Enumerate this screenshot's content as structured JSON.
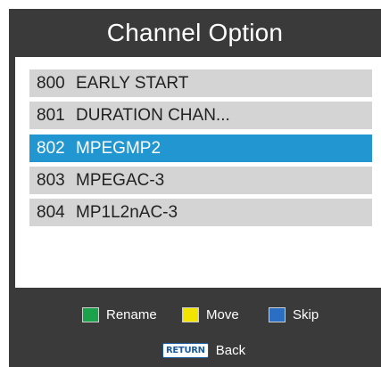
{
  "title": "Channel Option",
  "channels": [
    {
      "num": "800",
      "name": "EARLY START",
      "selected": false
    },
    {
      "num": "801",
      "name": "DURATION CHAN...",
      "selected": false
    },
    {
      "num": "802",
      "name": "MPEGMP2",
      "selected": true
    },
    {
      "num": "803",
      "name": "MPEGAC-3",
      "selected": false
    },
    {
      "num": "804",
      "name": "MP1L2nAC-3",
      "selected": false
    }
  ],
  "legend": [
    {
      "label": "Rename",
      "color": "#1aa34a"
    },
    {
      "label": "Move",
      "color": "#f2e400"
    },
    {
      "label": "Skip",
      "color": "#2a6fc4"
    }
  ],
  "return_key": {
    "key_label": "RETURN",
    "label": "Back"
  }
}
